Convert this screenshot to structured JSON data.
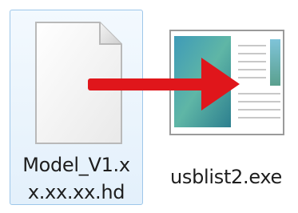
{
  "files": [
    {
      "label": "Model_V1.xx.xx.xx.hd",
      "icon": "document-icon",
      "selected": true
    },
    {
      "label": "usblist2.exe",
      "icon": "application-icon",
      "selected": false
    }
  ],
  "colors": {
    "selection_fill": "#e3f0fb",
    "selection_border": "#9ec7ea",
    "arrow": "#e0161b"
  }
}
